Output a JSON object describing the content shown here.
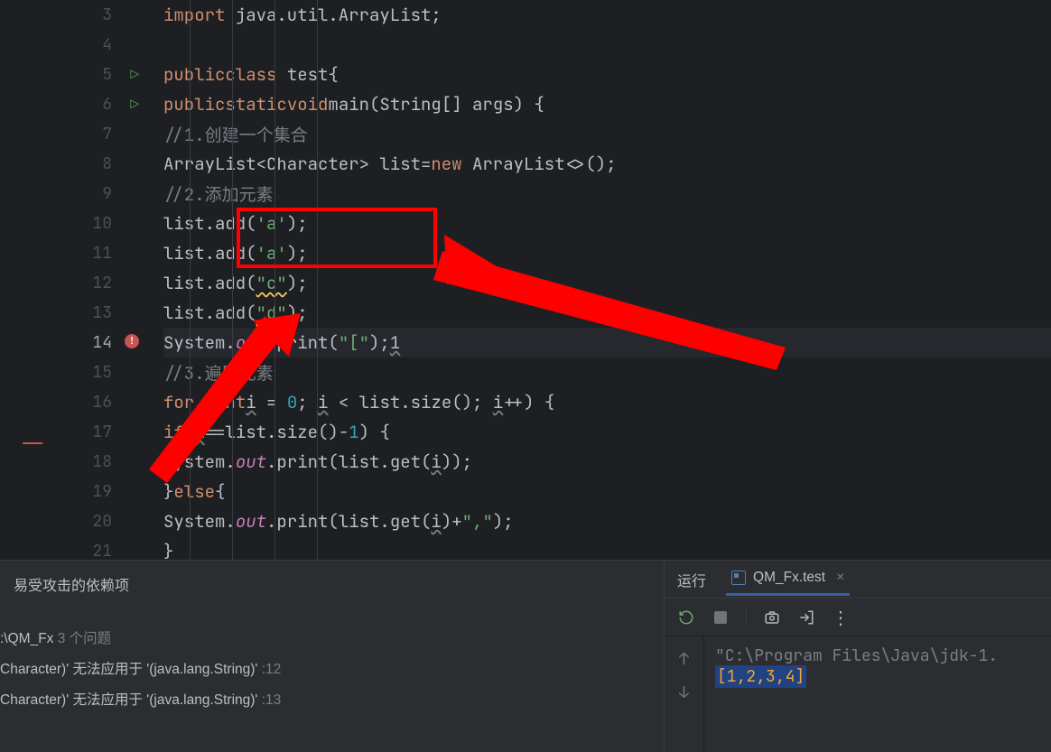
{
  "lineNumbers": [
    "3",
    "4",
    "5",
    "6",
    "7",
    "8",
    "9",
    "10",
    "11",
    "12",
    "13",
    "14",
    "15",
    "16",
    "17",
    "18",
    "19",
    "20",
    "21"
  ],
  "code": {
    "l3": {
      "import": "import",
      "pkg": " java.util.ArrayList;"
    },
    "l5": {
      "public": "public",
      "class": "class",
      "name": " test{"
    },
    "l6": {
      "public": "public",
      "static": "static",
      "void": "void",
      "main": "main",
      "params": "(String[] args) {"
    },
    "l7": "//1.创建一个集合",
    "l8": {
      "pre": "ArrayList<Character> list=",
      "new": "new",
      "post": " ArrayList<>();"
    },
    "l9": "//2.添加元素",
    "l10": {
      "pre": "list.add(",
      "chr": "'a'",
      "post": ");"
    },
    "l11": {
      "pre": "list.add(",
      "chr": "'a'",
      "post": ");"
    },
    "l12": {
      "pre": "list.add(",
      "str": "\"c\"",
      "post": ");"
    },
    "l13": {
      "pre": "list.add(",
      "str": "\"d\"",
      "post": ");"
    },
    "l14": {
      "sys": "System.",
      "out": "out",
      "print": ".print(",
      "str": "\"[\"",
      "post": ");",
      "jump": "1"
    },
    "l15": "//3.遍历元素",
    "l16": {
      "for": "for",
      "open": " (",
      "int": "int",
      "i": "i",
      "eq": " = ",
      "zero": "0",
      "semi": "; ",
      "i2": "i",
      "lt": " < list.size(); ",
      "i3": "i",
      "inc": "++) {"
    },
    "l17": {
      "if": "if",
      "open": "(",
      "i": "i",
      "mid": "==list.size()-",
      "one": "1",
      "post": ") {"
    },
    "l18": {
      "sys": "System.",
      "out": "out",
      "print": ".print(list.get(",
      "i": "i",
      "post": "));"
    },
    "l19": {
      "else": "else",
      "pre": "}",
      "post": "{"
    },
    "l20": {
      "sys": "System.",
      "out": "out",
      "print": ".print(list.get(",
      "i": "i",
      "post": ")+",
      "str": "\",\"",
      "end": ");"
    },
    "l21": "}"
  },
  "problems": {
    "title": "易受攻击的依赖项",
    "project": "QM_Fx",
    "count": "3 个问题",
    "msg": "Character)' 无法应用于 '(java.lang.String)'",
    "line1": ":12",
    "line2": ":13"
  },
  "run": {
    "tabLabel": "运行",
    "tabName": "QM_Fx.test",
    "consolePath": "\"C:\\Program Files\\Java\\jdk-1.",
    "consoleOutput": "[1,2,3,4]"
  }
}
